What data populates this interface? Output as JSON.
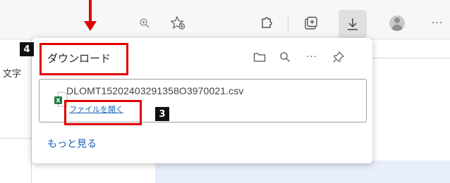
{
  "toolbar": {
    "icons": [
      "zoom-icon",
      "add-favorite-icon",
      "extensions-icon",
      "collections-icon",
      "download-icon",
      "profile-icon",
      "more-icon"
    ],
    "more_label": "···"
  },
  "page": {
    "side_text": "文字"
  },
  "downloads_panel": {
    "title": "ダウンロード",
    "tools": [
      "open-folder-icon",
      "search-icon",
      "more-icon",
      "pin-icon"
    ],
    "more_label": "···",
    "item": {
      "filename": "DLOMT15202403291358O3970021.csv",
      "open_label": "ファイルを開く",
      "file_type": "csv"
    },
    "see_more": "もっと見る"
  },
  "annotations": {
    "badge_4": "4",
    "badge_3": "3",
    "color": "#e00000"
  }
}
